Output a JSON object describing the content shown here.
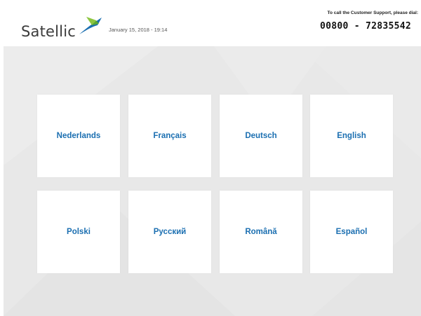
{
  "header": {
    "logo_text": "Satellic",
    "logo_icon": "satellic-swoosh-logo",
    "datetime": "January 15, 2018 - 19:14",
    "support_note": "To call the Customer Support, please dial:",
    "support_phone": "00800 - 72835542"
  },
  "languages": [
    {
      "label": "Nederlands"
    },
    {
      "label": "Français"
    },
    {
      "label": "Deutsch"
    },
    {
      "label": "English"
    },
    {
      "label": "Polski"
    },
    {
      "label": "Русский"
    },
    {
      "label": "Română"
    },
    {
      "label": "Español"
    }
  ],
  "colors": {
    "tile_label": "#1b6fb1",
    "background": "#e8e8e8",
    "logo_green": "#8cc63f",
    "logo_blue": "#1b6fb1"
  }
}
